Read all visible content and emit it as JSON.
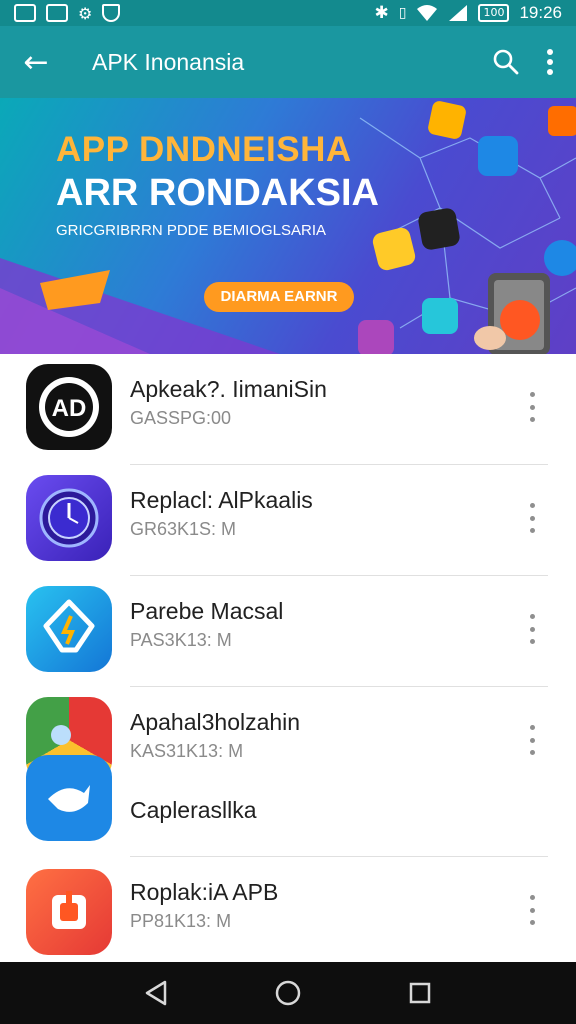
{
  "status_bar": {
    "time": "19:26",
    "battery": "100",
    "left_icons": [
      "gallery-icon",
      "photo-icon",
      "game-icon",
      "shield-icon"
    ],
    "right_icons": [
      "bluetooth-icon",
      "vibrate-icon",
      "wifi-icon",
      "signal-icon",
      "battery-icon"
    ]
  },
  "app_bar": {
    "title": "APK Inonansia",
    "back_icon": "arrow-left-icon",
    "search_icon": "search-icon",
    "menu_icon": "more-vert-icon"
  },
  "banner": {
    "headline": "APP DNDNEISHA",
    "headline2": "ARR RONDAKSIA",
    "subtitle": "GRICGRIBRRN PDDE BEMIOGLSARIA",
    "cta_label": "DIARMA EARNR",
    "colors": {
      "headline": "#ffb53a",
      "cta": "#ff9a1f"
    }
  },
  "apps": [
    {
      "name": "Apkeak?. IimaniSin",
      "meta": "GASSPG:00",
      "icon": "dark-logo-icon",
      "color": "#111111"
    },
    {
      "name": "Replacl: AlPkaalis",
      "meta": "GR63K1S: M",
      "icon": "compass-clock-icon",
      "color": "#4b2fcf"
    },
    {
      "name": "Parebe Macsal",
      "meta": "PAS3K13: M",
      "icon": "shield-bolt-icon",
      "color": "#1aa6e8"
    },
    {
      "name": "Apahal3holzahin",
      "meta": "KAS31K13: M",
      "icon": "chrome-like-icon",
      "color": "#e53935"
    },
    {
      "name": "Caplerasllka",
      "meta": "",
      "icon": "bird-icon",
      "color": "#1e88e5"
    },
    {
      "name": "Roplak:iA APB",
      "meta": "PP81K13: M",
      "icon": "orange-app-icon",
      "color": "#ff5722"
    }
  ],
  "nav_bar": {
    "back_icon": "triangle-back-icon",
    "home_icon": "circle-home-icon",
    "recents_icon": "square-recents-icon"
  }
}
